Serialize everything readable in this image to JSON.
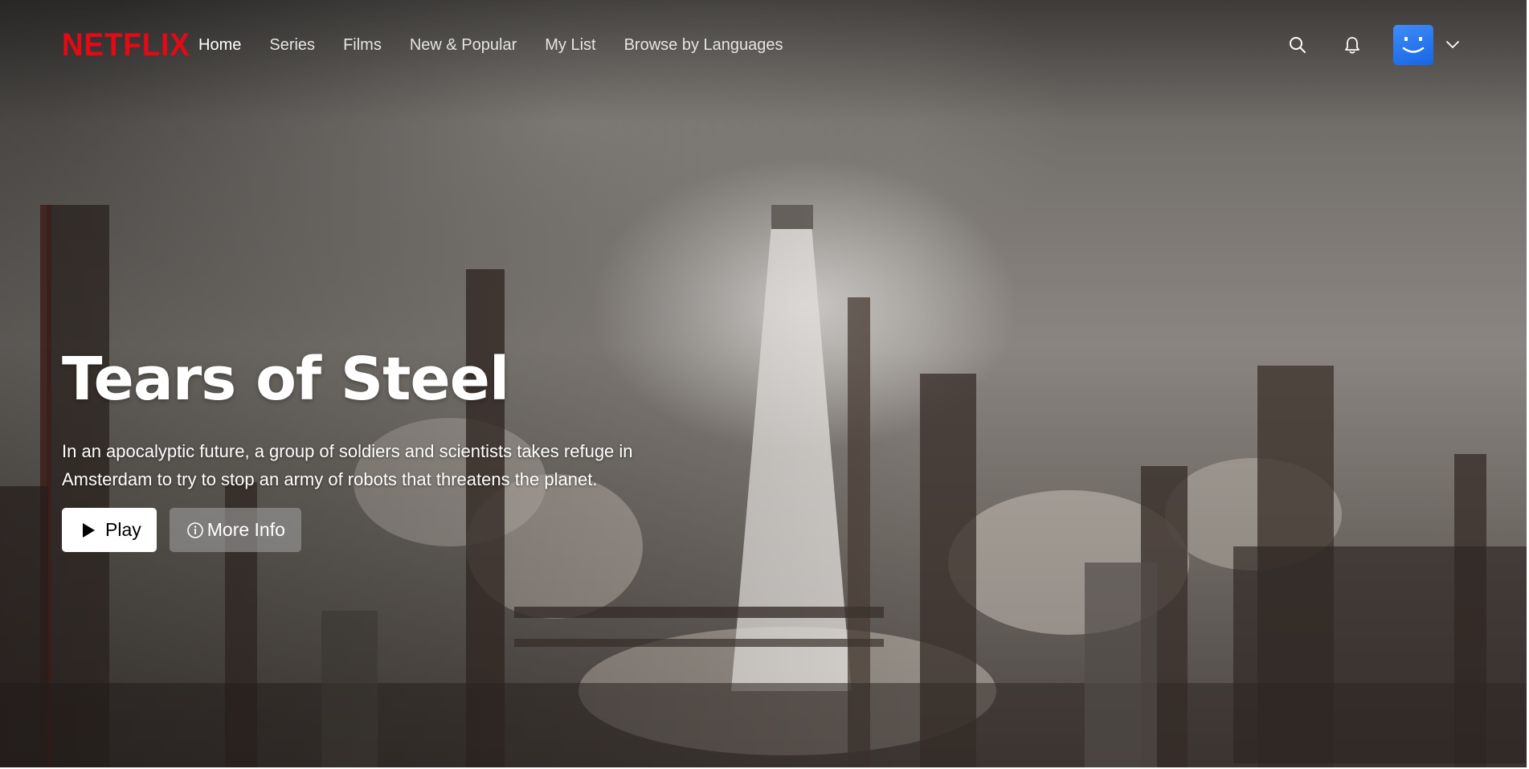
{
  "brand": {
    "logo_text": "NETFLIX",
    "logo_color": "#e50914"
  },
  "nav": {
    "items": [
      {
        "label": "Home",
        "active": true
      },
      {
        "label": "Series",
        "active": false
      },
      {
        "label": "Films",
        "active": false
      },
      {
        "label": "New & Popular",
        "active": false
      },
      {
        "label": "My List",
        "active": false
      },
      {
        "label": "Browse by Languages",
        "active": false
      }
    ],
    "icons": {
      "search": "search-icon",
      "notifications": "bell-icon",
      "profile": "avatar",
      "menu": "chevron-down-icon"
    },
    "avatar_color": "#2a7bf0"
  },
  "hero": {
    "title": "Tears of Steel",
    "description": "In an apocalyptic future, a group of soldiers and scientists takes refuge in Amsterdam to try to stop an army of robots that threatens the planet.",
    "buttons": {
      "play_label": "Play",
      "more_info_label": "More Info"
    }
  }
}
